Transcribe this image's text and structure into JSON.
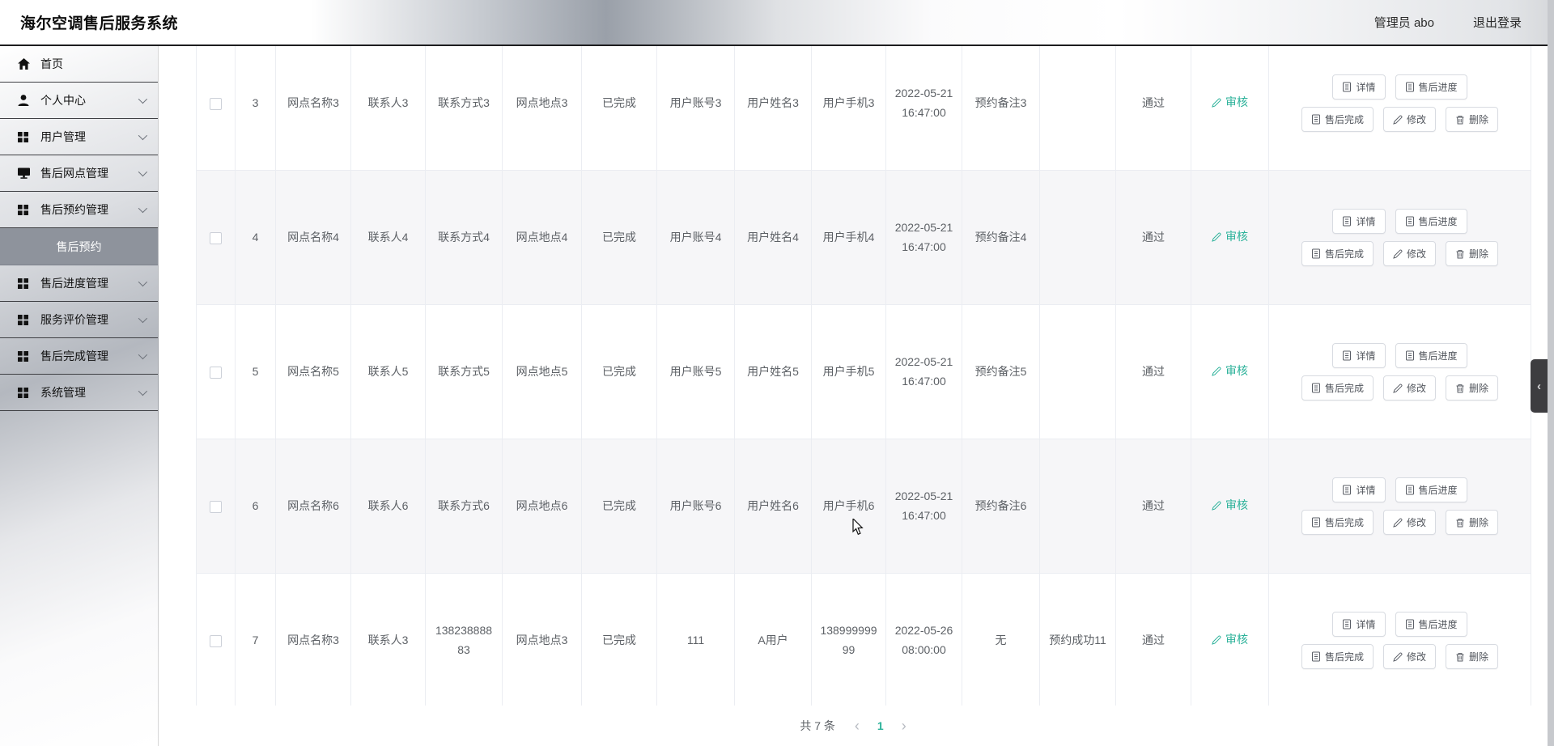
{
  "app": {
    "title": "海尔空调售后服务系统"
  },
  "header": {
    "user_label": "管理员 abo",
    "logout_label": "退出登录"
  },
  "sidebar": {
    "items": [
      {
        "label": "首页",
        "icon": "home-icon",
        "expandable": false
      },
      {
        "label": "个人中心",
        "icon": "person-icon",
        "expandable": true
      },
      {
        "label": "用户管理",
        "icon": "grid-icon",
        "expandable": true
      },
      {
        "label": "售后网点管理",
        "icon": "monitor-icon",
        "expandable": true
      },
      {
        "label": "售后预约管理",
        "icon": "grid-icon",
        "expandable": true,
        "children": [
          {
            "label": "售后预约",
            "active": true
          }
        ]
      },
      {
        "label": "售后进度管理",
        "icon": "grid-icon",
        "expandable": true
      },
      {
        "label": "服务评价管理",
        "icon": "grid-icon",
        "expandable": true
      },
      {
        "label": "售后完成管理",
        "icon": "grid-icon",
        "expandable": true
      },
      {
        "label": "系统管理",
        "icon": "grid-icon",
        "expandable": true
      }
    ]
  },
  "table": {
    "audit_label": "审核",
    "action_labels": {
      "detail": "详情",
      "progress": "售后进度",
      "complete": "售后完成",
      "edit": "修改",
      "delete": "删除"
    },
    "rows": [
      {
        "index": "3",
        "outlet_name": "网点名称3",
        "contact": "联系人3",
        "contact_method": "联系方式3",
        "address": "网点地点3",
        "status": "已完成",
        "account": "用户账号3",
        "user_name": "用户姓名3",
        "phone": "用户手机3",
        "time": "2022-05-21 16:47:00",
        "remark": "预约备注3",
        "success": "",
        "audit_status": "通过"
      },
      {
        "index": "4",
        "outlet_name": "网点名称4",
        "contact": "联系人4",
        "contact_method": "联系方式4",
        "address": "网点地点4",
        "status": "已完成",
        "account": "用户账号4",
        "user_name": "用户姓名4",
        "phone": "用户手机4",
        "time": "2022-05-21 16:47:00",
        "remark": "预约备注4",
        "success": "",
        "audit_status": "通过"
      },
      {
        "index": "5",
        "outlet_name": "网点名称5",
        "contact": "联系人5",
        "contact_method": "联系方式5",
        "address": "网点地点5",
        "status": "已完成",
        "account": "用户账号5",
        "user_name": "用户姓名5",
        "phone": "用户手机5",
        "time": "2022-05-21 16:47:00",
        "remark": "预约备注5",
        "success": "",
        "audit_status": "通过"
      },
      {
        "index": "6",
        "outlet_name": "网点名称6",
        "contact": "联系人6",
        "contact_method": "联系方式6",
        "address": "网点地点6",
        "status": "已完成",
        "account": "用户账号6",
        "user_name": "用户姓名6",
        "phone": "用户手机6",
        "time": "2022-05-21 16:47:00",
        "remark": "预约备注6",
        "success": "",
        "audit_status": "通过"
      },
      {
        "index": "7",
        "outlet_name": "网点名称3",
        "contact": "联系人3",
        "contact_method": "13823888883",
        "address": "网点地点3",
        "status": "已完成",
        "account": "111",
        "user_name": "A用户",
        "phone": "13899999999",
        "time": "2022-05-26 08:00:00",
        "remark": "无",
        "success": "预约成功11",
        "audit_status": "通过"
      }
    ]
  },
  "pagination": {
    "total_label": "共 7 条",
    "prev_icon": "‹",
    "next_icon": "›",
    "current_page": "1"
  },
  "side_panel": {
    "collapse_icon": "‹"
  },
  "colors": {
    "accent_green": "#2cb29a",
    "submenu_active_bg": "#8e939c",
    "stripe_row_bg": "#f6f6f8",
    "header_dark_gray": "#9aa0a9"
  }
}
